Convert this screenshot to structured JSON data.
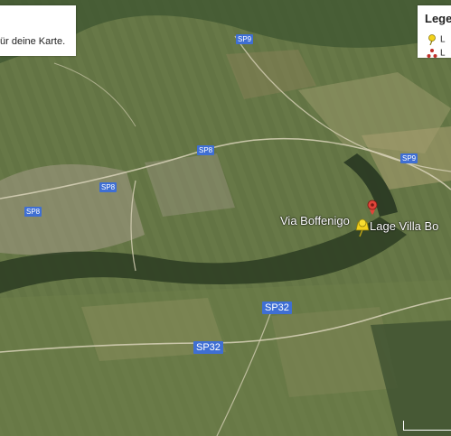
{
  "description": {
    "text": "ür deine Karte."
  },
  "legend": {
    "title": "Lege",
    "items": [
      {
        "label": "L",
        "icon": "yellow-pin-icon",
        "color": "#f3d21a"
      },
      {
        "label": "L",
        "icon": "red-triangle-dots-icon",
        "color": "#c0302a"
      }
    ]
  },
  "road_labels": [
    {
      "text": "SP9"
    },
    {
      "text": "SP8"
    },
    {
      "text": "SP8"
    },
    {
      "text": "SP8"
    },
    {
      "text": "SP9"
    },
    {
      "text": "SP32"
    },
    {
      "text": "SP32"
    }
  ],
  "places": {
    "via_boffenigo": "Via Boffenigo",
    "lage_villa": "Lage Villa Bo"
  },
  "colors": {
    "road_badge": "#3f6fd3",
    "marker_red": "#e0453a",
    "pin_yellow": "#f2d01c"
  }
}
